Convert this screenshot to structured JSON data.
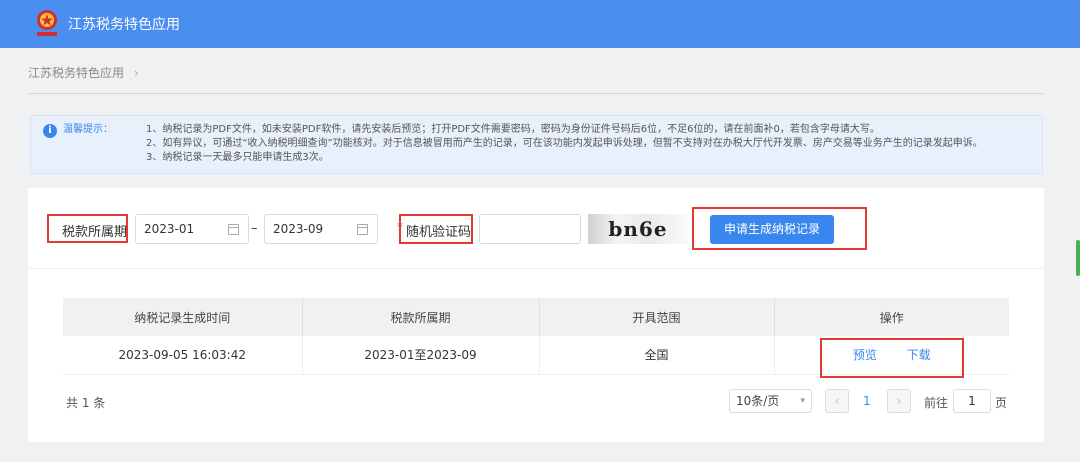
{
  "app": {
    "title": "江苏税务特色应用"
  },
  "breadcrumb": {
    "item": "江苏税务特色应用",
    "separator": "›"
  },
  "notice": {
    "label": "温馨提示：",
    "lines": [
      "1、纳税记录为PDF文件，如未安装PDF软件，请先安装后预览；打开PDF文件需要密码，密码为身份证件号码后6位，不足6位的，请在前面补0，若包含字母请大写。",
      "2、如有异议，可通过“收入纳税明细查询”功能核对。对于信息被冒用而产生的记录，可在该功能内发起申诉处理，但暂不支持对在办税大厅代开发票、房产交易等业务产生的记录发起申诉。",
      "3、纳税记录一天最多只能申请生成3次。"
    ]
  },
  "form": {
    "period_label": "税款所属期",
    "start_date": "2023-01",
    "dash": "–",
    "end_date": "2023-09",
    "required_mark": "*",
    "captcha_label": "随机验证码",
    "captcha_value": "",
    "captcha_text": "bn6e",
    "submit_label": "申请生成纳税记录"
  },
  "table": {
    "headers": [
      "纳税记录生成时间",
      "税款所属期",
      "开具范围",
      "操作"
    ],
    "rows": [
      {
        "time": "2023-09-05 16:03:42",
        "period": "2023-01至2023-09",
        "scope": "全国",
        "preview": "预览",
        "download": "下载"
      }
    ]
  },
  "pagination": {
    "total": "共 1 条",
    "page_size": "10条/页",
    "prev": "‹",
    "page": "1",
    "next": "›",
    "goto_label": "前往",
    "goto_value": "1",
    "page_unit": "页"
  },
  "colors": {
    "brand": "#4a8ef0",
    "primary": "#3a86ef",
    "highlight": "#e53935"
  }
}
